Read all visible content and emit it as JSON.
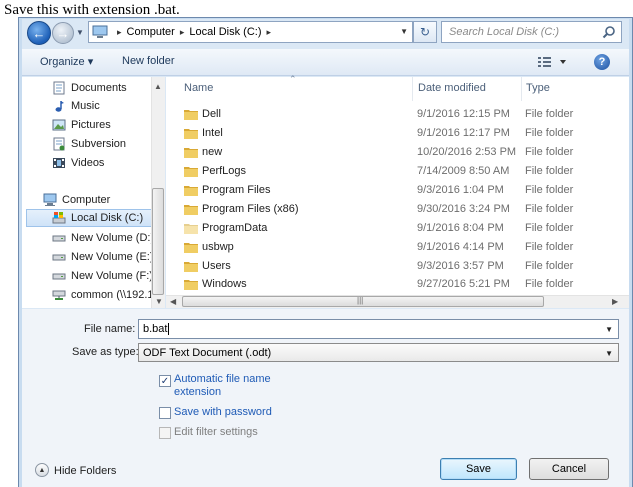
{
  "caption": "Save this with extension .bat.",
  "nav": {
    "breadcrumb": [
      "Computer",
      "Local Disk (C:)"
    ],
    "search_placeholder": "Search Local Disk (C:)"
  },
  "toolbar": {
    "organize": "Organize ▾",
    "new_folder": "New folder"
  },
  "navpane": {
    "items": [
      {
        "label": "Documents",
        "icon": "documents-icon"
      },
      {
        "label": "Music",
        "icon": "music-icon"
      },
      {
        "label": "Pictures",
        "icon": "pictures-icon"
      },
      {
        "label": "Subversion",
        "icon": "subversion-icon"
      },
      {
        "label": "Videos",
        "icon": "videos-icon"
      },
      {
        "label": "Computer",
        "icon": "computer-icon"
      },
      {
        "label": "Local Disk (C:)",
        "icon": "local-disk-icon"
      },
      {
        "label": "New Volume (D:)",
        "icon": "drive-icon"
      },
      {
        "label": "New Volume (E:)",
        "icon": "drive-icon"
      },
      {
        "label": "New Volume (F:)",
        "icon": "drive-icon"
      },
      {
        "label": "common (\\\\192.1",
        "icon": "network-drive-icon"
      }
    ]
  },
  "columns": {
    "name": "Name",
    "date": "Date modified",
    "type": "Type"
  },
  "files": [
    {
      "name": "Dell",
      "date": "9/1/2016 12:15 PM",
      "type": "File folder"
    },
    {
      "name": "Intel",
      "date": "9/1/2016 12:17 PM",
      "type": "File folder"
    },
    {
      "name": "new",
      "date": "10/20/2016 2:53 PM",
      "type": "File folder"
    },
    {
      "name": "PerfLogs",
      "date": "7/14/2009 8:50 AM",
      "type": "File folder"
    },
    {
      "name": "Program Files",
      "date": "9/3/2016 1:04 PM",
      "type": "File folder"
    },
    {
      "name": "Program Files (x86)",
      "date": "9/30/2016 3:24 PM",
      "type": "File folder"
    },
    {
      "name": "ProgramData",
      "date": "9/1/2016 8:04 PM",
      "type": "File folder"
    },
    {
      "name": "usbwp",
      "date": "9/1/2016 4:14 PM",
      "type": "File folder"
    },
    {
      "name": "Users",
      "date": "9/3/2016 3:57 PM",
      "type": "File folder"
    },
    {
      "name": "Windows",
      "date": "9/27/2016 5:21 PM",
      "type": "File folder"
    }
  ],
  "form": {
    "file_name_label": "File name:",
    "file_name_value": "b.bat",
    "save_type_label": "Save as type:",
    "save_type_value": "ODF Text Document (.odt)",
    "auto_ext_line1": "Automatic file name",
    "auto_ext_line2": "extension",
    "save_password": "Save with password",
    "edit_filter": "Edit filter settings"
  },
  "footer": {
    "hide_folders": "Hide Folders",
    "save": "Save",
    "cancel": "Cancel"
  },
  "colors": {
    "accent": "#1f5bb6",
    "folder": "#e8c15a"
  }
}
